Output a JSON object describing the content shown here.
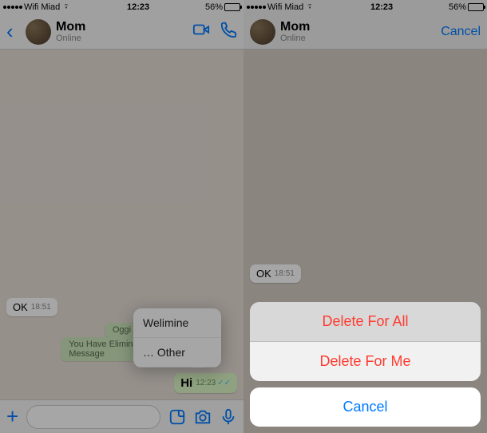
{
  "status": {
    "carrier": "Wifi Miad",
    "time": "12:23",
    "battery_pct": "56%"
  },
  "left": {
    "chat_name": "Mom",
    "chat_status": "Online",
    "messages": {
      "ok_text": "OK",
      "ok_time": "18:51",
      "you_eliminated": "You Have Eliminated This Message",
      "oggi": "Oggi",
      "hi_text": "Hi",
      "hi_time": "12:23"
    },
    "context_menu": {
      "item1": "Welimine",
      "item2": "… Other"
    }
  },
  "right": {
    "chat_name": "Mom",
    "chat_status": "Online",
    "cancel": "Cancel",
    "messages": {
      "ok_text": "OK",
      "ok_time": "18:51"
    },
    "sheet": {
      "delete_all": "Delete For All",
      "delete_me": "Delete For Me",
      "cancel": "Cancel"
    }
  }
}
